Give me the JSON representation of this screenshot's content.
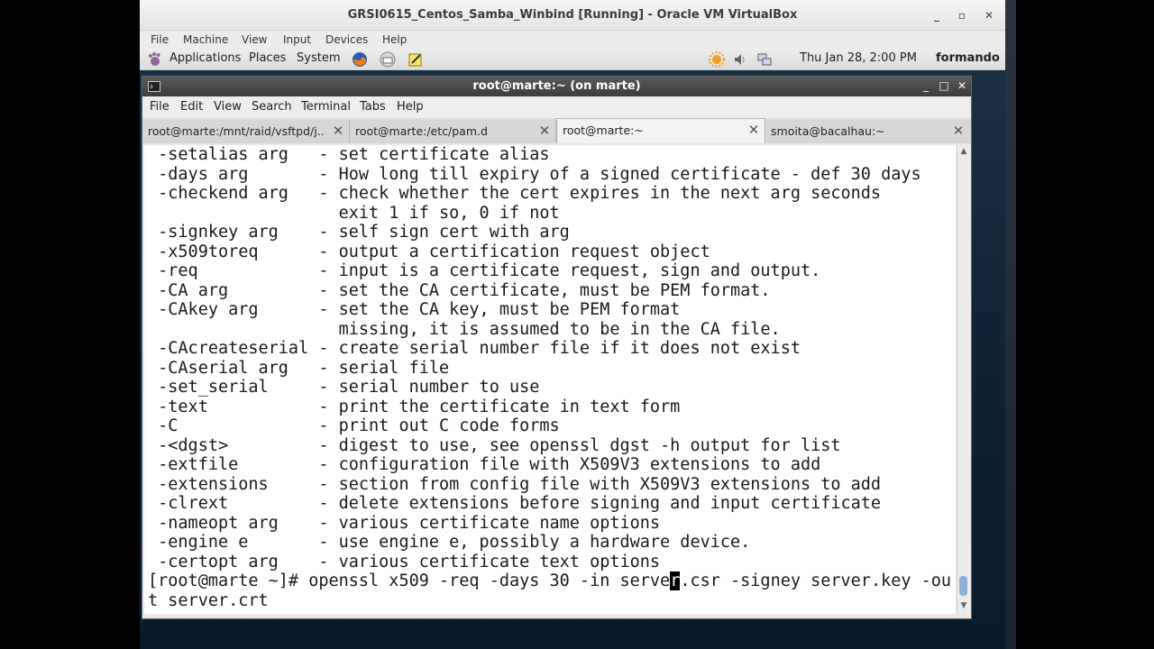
{
  "vbox": {
    "title": "GRSI0615_Centos_Samba_Winbind [Running] - Oracle VM VirtualBox",
    "menu": [
      "File",
      "Machine",
      "View",
      "Input",
      "Devices",
      "Help"
    ],
    "controls": {
      "minimize": "_",
      "maximize": "▫",
      "close": "✕"
    }
  },
  "panel": {
    "applications": "Applications",
    "places": "Places",
    "system": "System",
    "datetime": "Thu Jan 28,  2:00 PM",
    "user": "formando"
  },
  "terminal": {
    "title": "root@marte:~ (on marte)",
    "menu": [
      "File",
      "Edit",
      "View",
      "Search",
      "Terminal",
      "Tabs",
      "Help"
    ],
    "tabs": [
      {
        "label": "root@marte:/mnt/raid/vsftpd/j..."
      },
      {
        "label": "root@marte:/etc/pam.d"
      },
      {
        "label": "root@marte:~"
      },
      {
        "label": "smoita@bacalhau:~"
      }
    ],
    "lines": [
      " -setalias arg   - set certificate alias",
      " -days arg       - How long till expiry of a signed certificate - def 30 days",
      " -checkend arg   - check whether the cert expires in the next arg seconds",
      "                   exit 1 if so, 0 if not",
      " -signkey arg    - self sign cert with arg",
      " -x509toreq      - output a certification request object",
      " -req            - input is a certificate request, sign and output.",
      " -CA arg         - set the CA certificate, must be PEM format.",
      " -CAkey arg      - set the CA key, must be PEM format",
      "                   missing, it is assumed to be in the CA file.",
      " -CAcreateserial - create serial number file if it does not exist",
      " -CAserial arg   - serial file",
      " -set_serial     - serial number to use",
      " -text           - print the certificate in text form",
      " -C              - print out C code forms",
      " -<dgst>         - digest to use, see openssl dgst -h output for list",
      " -extfile        - configuration file with X509V3 extensions to add",
      " -extensions     - section from config file with X509V3 extensions to add",
      " -clrext         - delete extensions before signing and input certificate",
      " -nameopt arg    - various certificate name options",
      " -engine e       - use engine e, possibly a hardware device.",
      " -certopt arg    - various certificate text options"
    ],
    "prompt_before_cursor": "[root@marte ~]# openssl x509 -req -days 30 -in serve",
    "cursor_char": "r",
    "prompt_after_cursor": ".csr -signey server.key -ou",
    "wrap_line": "t server.crt"
  }
}
